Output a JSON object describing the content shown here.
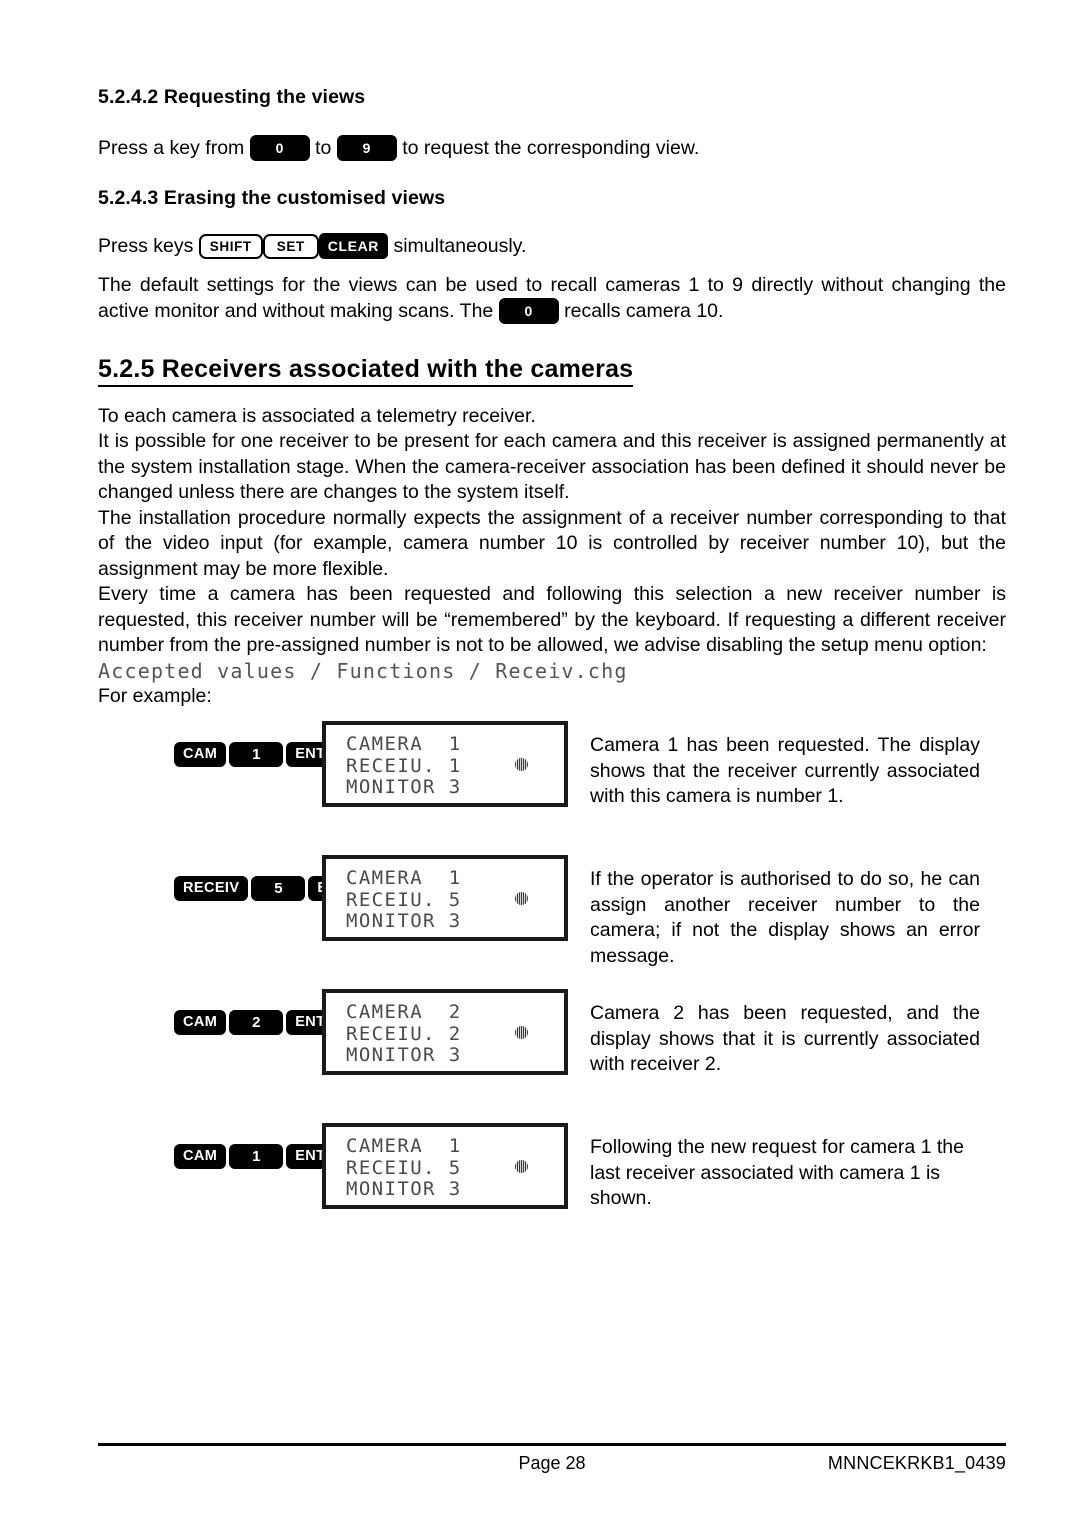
{
  "sections": {
    "s5242": {
      "heading": "5.2.4.2 Requesting the views",
      "line_before": "Press a key from",
      "key_from": "0",
      "line_mid": "to",
      "key_to": "9",
      "line_after": "to request the corresponding view."
    },
    "s5243": {
      "heading": "5.2.4.3 Erasing the customised views",
      "press_keys_label": "Press keys",
      "key_shift": "SHIFT",
      "key_set": "SET",
      "key_clear": "CLEAR",
      "simultaneously": "simultaneously.",
      "default_part1": "The default settings for the views can be used to recall cameras 1 to 9 directly without changing the active monitor and without making scans. The",
      "key_zero": "0",
      "default_part2": "recalls camera 10."
    },
    "s525": {
      "heading": "5.2.5 Receivers associated with the cameras",
      "p1": "To each camera is associated a telemetry receiver.",
      "p2": "It is possible for one receiver to be present for each camera and this receiver is assigned permanently at the system installation stage. When the camera-receiver association has been defined it should never be changed unless there are changes to the system itself.",
      "p3": "The installation procedure normally expects the assignment of a receiver number corresponding to that of the video input (for example, camera number 10 is controlled by receiver number 10), but the assignment may be more flexible.",
      "p4": "Every time a camera has been requested and following this selection a new receiver number is requested, this receiver number will be “remembered” by the keyboard. If requesting a different receiver number from the pre-assigned number is not to be allowed, we advise disabling the setup menu option:",
      "menu_path": "Accepted values / Functions / Receiv.chg",
      "for_example": "For example:"
    }
  },
  "examples": [
    {
      "key_label": "CAM",
      "key_num": "1",
      "key_enter": "ENTER",
      "lcd": "CAMERA  1\nRECEIU. 1\nMONITOR 3",
      "led": "indicator-led",
      "description": "Camera 1 has been requested. The display shows that the receiver currently associated with this camera is number 1."
    },
    {
      "key_label": "RECEIV",
      "key_num": "5",
      "key_enter": "ENTER",
      "lcd": "CAMERA  1\nRECEIU. 5\nMONITOR 3",
      "led": "indicator-led",
      "description": "If the operator is authorised to do so, he can assign another receiver number to the camera; if not the display shows an error message."
    },
    {
      "key_label": "CAM",
      "key_num": "2",
      "key_enter": "ENTER",
      "lcd": "CAMERA  2\nRECEIU. 2\nMONITOR 3",
      "led": "indicator-led",
      "description": "Camera 2 has been requested, and the display shows that it is currently associated with receiver 2."
    },
    {
      "key_label": "CAM",
      "key_num": "1",
      "key_enter": "ENTER",
      "lcd": "CAMERA  1\nRECEIU. 5\nMONITOR 3",
      "led": "indicator-led",
      "description": "Following the new request for camera 1 the last receiver associated with camera 1 is shown."
    }
  ],
  "footer": {
    "page": "Page 28",
    "doc_code": "MNNCEKRKB1_0439"
  }
}
